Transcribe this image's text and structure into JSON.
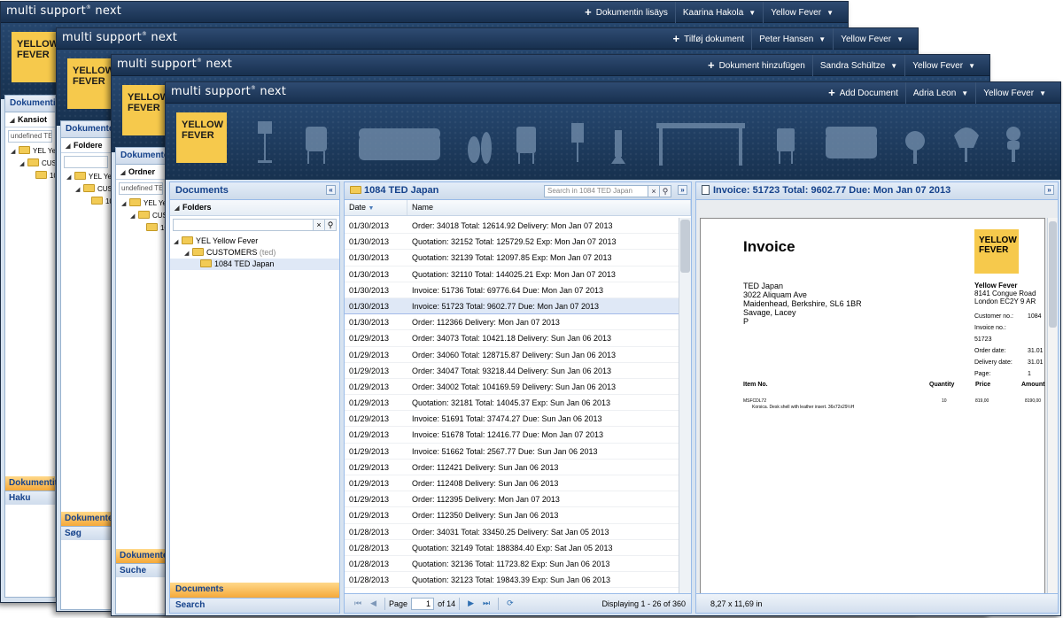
{
  "brand": {
    "app_name": "multi support",
    "app_suffix": "next",
    "reg_mark": "®",
    "logo_line1": "YELLOW",
    "logo_line2": "FEVER",
    "logo_color": "#f6c94c"
  },
  "windows": [
    {
      "add_label": "Dokumentin lisäys",
      "user": "Kaarina Hakola",
      "company": "Yellow Fever",
      "panel_title": "Dokumentit",
      "folders_label": "Kansiot",
      "input_value": "undefined TED",
      "tree": [
        "YEL Yellow",
        "CUSTO",
        "1084"
      ],
      "bottom_active": "Dokumentit",
      "bottom_search": "Haku"
    },
    {
      "add_label": "Tilføj dokument",
      "user": "Peter Hansen",
      "company": "Yellow Fever",
      "panel_title": "Dokumenter",
      "folders_label": "Foldere",
      "input_value": "",
      "tree": [
        "YEL Yellow",
        "CUSTO",
        "1084"
      ],
      "bottom_active": "Dokumenter",
      "bottom_search": "Søg"
    },
    {
      "add_label": "Dokument hinzufügen",
      "user": "Sandra Schültze",
      "company": "Yellow Fever",
      "panel_title": "Dokumente",
      "folders_label": "Ordner",
      "input_value": "undefined TED",
      "tree": [
        "YEL Yellow",
        "CUSTOI",
        "1084"
      ],
      "bottom_active": "Dokumente",
      "bottom_search": "Suche"
    }
  ],
  "front": {
    "add_label": "Add Document",
    "user": "Adria Leon",
    "company": "Yellow Fever",
    "left_panel": {
      "title": "Documents",
      "folders_label": "Folders",
      "tree": [
        {
          "label": "YEL Yellow Fever"
        },
        {
          "label": "CUSTOMERS",
          "extra": "(ted)"
        },
        {
          "label": "1084 TED Japan"
        }
      ],
      "bottom_active": "Documents",
      "bottom_search": "Search"
    },
    "list_panel": {
      "title": "1084 TED Japan",
      "search_placeholder": "Search in 1084 TED Japan",
      "col_date": "Date",
      "col_name": "Name",
      "rows": [
        {
          "date": "01/30/2013",
          "name": "Order: 34018 Total: 12614.92 Delivery: Mon Jan 07 2013"
        },
        {
          "date": "01/30/2013",
          "name": "Quotation: 32152 Total: 125729.52 Exp: Mon Jan 07 2013"
        },
        {
          "date": "01/30/2013",
          "name": "Quotation: 32139 Total: 12097.85 Exp: Mon Jan 07 2013"
        },
        {
          "date": "01/30/2013",
          "name": "Quotation: 32110 Total: 144025.21 Exp: Mon Jan 07 2013"
        },
        {
          "date": "01/30/2013",
          "name": "Invoice: 51736 Total: 69776.64 Due: Mon Jan 07 2013"
        },
        {
          "date": "01/30/2013",
          "name": "Invoice: 51723 Total: 9602.77 Due: Mon Jan 07 2013",
          "selected": true
        },
        {
          "date": "01/30/2013",
          "name": "Order: 112366 Delivery: Mon Jan 07 2013"
        },
        {
          "date": "01/29/2013",
          "name": "Order: 34073 Total: 10421.18 Delivery: Sun Jan 06 2013"
        },
        {
          "date": "01/29/2013",
          "name": "Order: 34060 Total: 128715.87 Delivery: Sun Jan 06 2013"
        },
        {
          "date": "01/29/2013",
          "name": "Order: 34047 Total: 93218.44 Delivery: Sun Jan 06  2013"
        },
        {
          "date": "01/29/2013",
          "name": "Order: 34002 Total: 104169.59 Delivery: Sun Jan 06 2013"
        },
        {
          "date": "01/29/2013",
          "name": "Quotation: 32181 Total: 14045.37 Exp: Sun Jan 06 2013"
        },
        {
          "date": "01/29/2013",
          "name": "Invoice: 51691 Total: 37474.27 Due: Sun Jan 06 2013"
        },
        {
          "date": "01/29/2013",
          "name": "Invoice: 51678 Total: 12416.77 Due: Mon Jan 07 2013"
        },
        {
          "date": "01/29/2013",
          "name": "Invoice: 51662 Total: 2567.77 Due: Sun Jan 06 2013"
        },
        {
          "date": "01/29/2013",
          "name": "Order: 112421 Delivery: Sun Jan 06  2013"
        },
        {
          "date": "01/29/2013",
          "name": "Order: 112408 Delivery: Sun Jan 06 2013"
        },
        {
          "date": "01/29/2013",
          "name": "Order: 112395 Delivery: Mon Jan 07 2013"
        },
        {
          "date": "01/29/2013",
          "name": "Order: 112350 Delivery: Sun Jan 06 2013"
        },
        {
          "date": "01/28/2013",
          "name": "Order: 34031 Total: 33450.25 Delivery: Sat Jan 05  2013"
        },
        {
          "date": "01/28/2013",
          "name": "Quotation: 32149 Total: 188384.40 Exp: Sat Jan 05 2013"
        },
        {
          "date": "01/28/2013",
          "name": "Quotation: 32136 Total: 11723.82 Exp: Sun Jan 06 2013"
        },
        {
          "date": "01/28/2013",
          "name": "Quotation: 32123 Total: 19843.39 Exp: Sun Jan 06 2013"
        }
      ],
      "page_label": "Page",
      "page_value": "1",
      "page_of": "of 14",
      "displaying": "Displaying 1 - 26 of 360"
    },
    "preview": {
      "title": "Invoice: 51723 Total: 9602.77 Due: Mon Jan 07 2013",
      "page_size": "8,27 x 11,69 in",
      "doc": {
        "heading": "Invoice",
        "to_name": "TED Japan",
        "to_addr1": "3022 Aliquam Ave",
        "to_addr2": "Maidenhead, Berkshire, SL6 1BR",
        "to_addr3": "Savage, Lacey",
        "to_addr4": "P",
        "logo1": "YELLOW",
        "logo2": "FEVER",
        "from_name": "Yellow Fever",
        "from_addr1": "8141  Congue Road",
        "from_addr2": "London EC2Y 9 AR",
        "customer_label": "Customer no.:",
        "customer_val": "1084",
        "invoice_label": "Invoice no.:",
        "invoice_val": "51723",
        "order_label": "Order date:",
        "order_val": "31.01",
        "delivery_label": "Delivery date:",
        "delivery_val": "31.01",
        "page_label": "Page:",
        "page_val": "1",
        "col_item": "Item No.",
        "col_qty": "Quantity",
        "col_price": "Price",
        "col_amount": "Amount",
        "item_no": "MSFCDL72",
        "item_desc": "Korsica. Desk shell with leather insert. 36x72x29½H",
        "item_qty": "10",
        "item_price": "819,00",
        "item_amount": "8190,00"
      }
    }
  }
}
